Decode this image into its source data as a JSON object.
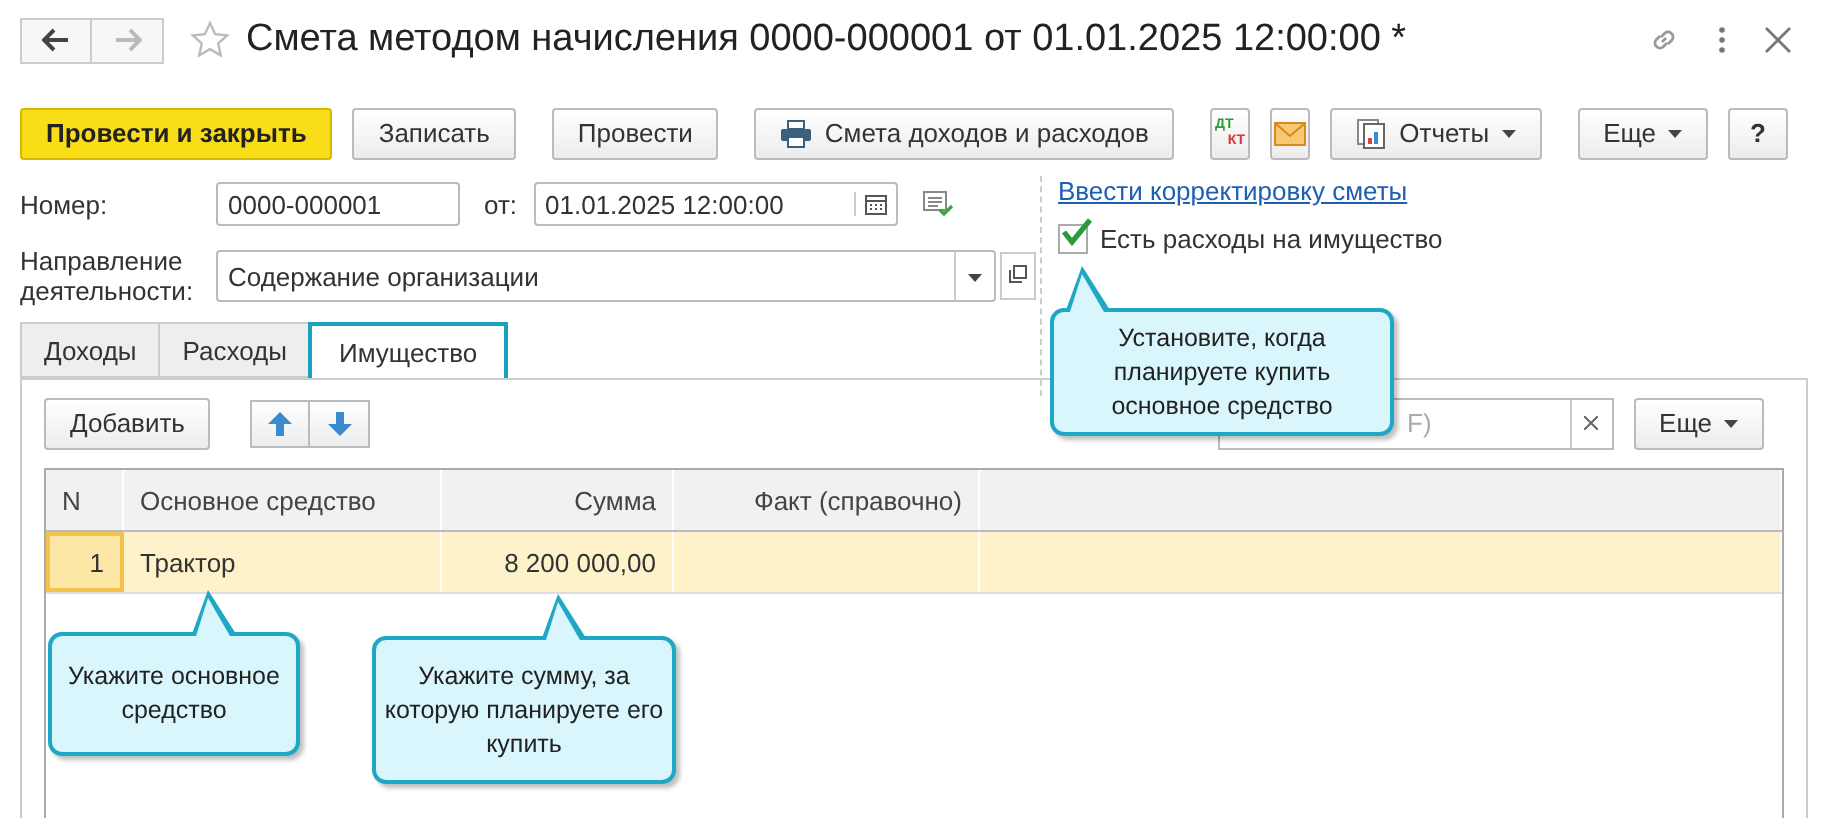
{
  "window": {
    "title": "Смета методом начисления 0000-000001 от 01.01.2025 12:00:00 *",
    "favorite": false
  },
  "toolbar": [
    {
      "kind": "primary",
      "label": "Провести и закрыть"
    },
    {
      "kind": "plain",
      "label": "Записать"
    },
    {
      "kind": "plain",
      "label": "Провести"
    },
    {
      "kind": "print",
      "label": "Смета доходов и расходов"
    },
    {
      "kind": "dtkt",
      "top": "ДТ",
      "bottom": "КТ"
    },
    {
      "kind": "mail"
    },
    {
      "kind": "reports",
      "label": "Отчеты"
    },
    {
      "kind": "menu",
      "label": "Еще"
    },
    {
      "kind": "plain",
      "label": "?"
    }
  ],
  "number": {
    "label": "Номер:",
    "value": "0000-000001"
  },
  "date": {
    "label": "от:",
    "value": "01.01.2025 12:00:00"
  },
  "direction": {
    "label": "Направление деятельности:",
    "value": "Содержание организации"
  },
  "link": "Ввести корректировку сметы",
  "asset_checkbox": {
    "label": "Есть расходы на имущество",
    "checked": true
  },
  "tabs": [
    {
      "label": "Доходы",
      "selected": false
    },
    {
      "label": "Расходы",
      "selected": false
    },
    {
      "label": "Имущество",
      "selected": true
    }
  ],
  "table_toolbar": {
    "add": "Добавить",
    "search_placeholder": "F)",
    "more": "Еще"
  },
  "table": {
    "columns": [
      "N",
      "Основное средство",
      "Сумма",
      "Факт (справочно)"
    ],
    "rows": [
      {
        "n": "1",
        "asset": "Трактор",
        "sum": "8 200 000,00",
        "selected": true
      }
    ]
  },
  "callouts": [
    "Установите, когда планируете купить основное средство",
    "Укажите основное средство",
    "Укажите сумму, за которую планируете его купить"
  ]
}
